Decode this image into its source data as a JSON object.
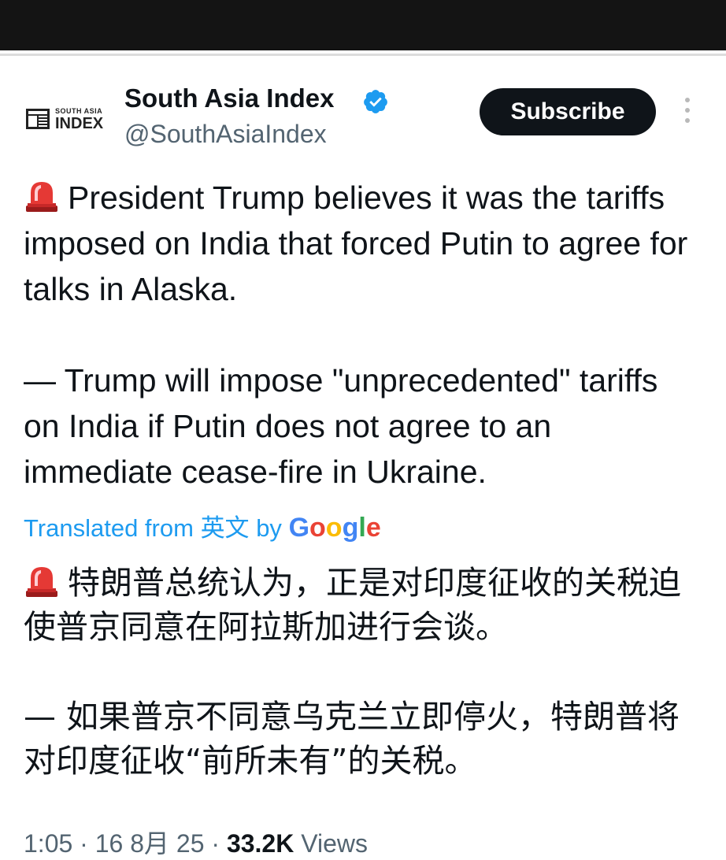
{
  "account": {
    "logo_small": "SOUTH ASIA",
    "logo_big": "INDEX",
    "display_name": "South Asia Index",
    "handle": "@SouthAsiaIndex",
    "verified_icon": "verified-badge-icon"
  },
  "actions": {
    "subscribe_label": "Subscribe",
    "more_icon": "more-vertical-icon"
  },
  "tweet": {
    "paragraph_1": "President Trump believes it was the tariffs imposed on India that forced Putin to agree for talks in Alaska.",
    "paragraph_2": "— Trump will impose \"unprecedented\" tariffs on India if Putin does not agree to an immediate cease-fire in Ukraine.",
    "siren_icon": "rotating-light-icon"
  },
  "translation": {
    "prefix": "Translated from",
    "source_lang": "英文",
    "by": "by",
    "provider": "Google",
    "paragraph_1": "特朗普总统认为，正是对印度征收的关税迫使普京同意在阿拉斯加进行会谈。",
    "paragraph_2": "— 如果普京不同意乌克兰立即停火，特朗普将对印度征收“前所未有”的关税。"
  },
  "meta": {
    "time": "1:05",
    "dot": "·",
    "date": "16 8月 25",
    "views_count": "33.2K",
    "views_label": "Views"
  },
  "colors": {
    "link_blue": "#1d9bf0",
    "button_dark": "#0f1419",
    "secondary_text": "#536471"
  }
}
